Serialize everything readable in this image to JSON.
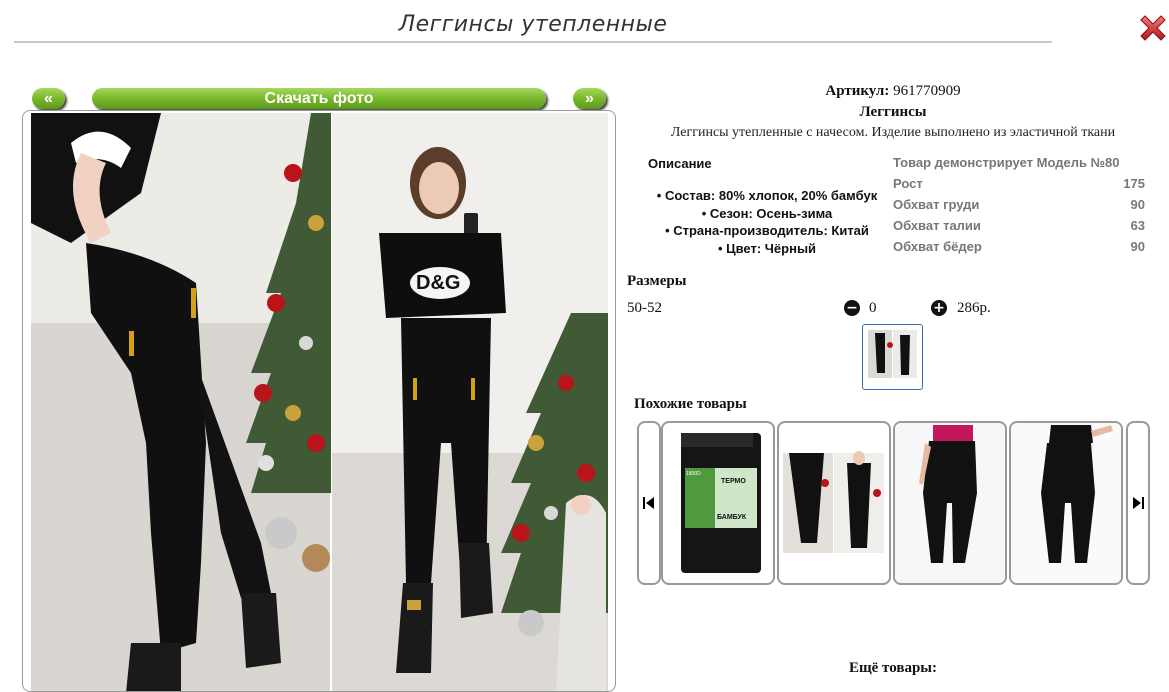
{
  "page": {
    "title": "Леггинсы утепленные",
    "close_icon": "close-icon"
  },
  "gallery": {
    "prev_label": "«",
    "next_label": "»",
    "download_label": "Скачать фото"
  },
  "product": {
    "article_label": "Артикул:",
    "article_value": "961770909",
    "name": "Леггинсы",
    "description": "Леггинсы утепленные с начесом. Изделие выполнено из эластичной ткани",
    "desc_heading": "Описание",
    "bullets": [
      "• Состав: 80% хлопок, 20% бамбук",
      "• Сезон: Осень-зима",
      "• Страна-производитель: Китай",
      "• Цвет: Чёрный"
    ]
  },
  "model": {
    "title": "Товар демонстрирует Модель №80",
    "rows": [
      {
        "label": "Рост",
        "value": "175"
      },
      {
        "label": "Обхват груди",
        "value": "90"
      },
      {
        "label": "Обхват талии",
        "value": "63"
      },
      {
        "label": "Обхват бёдер",
        "value": "90"
      }
    ]
  },
  "sizes": {
    "heading": "Размеры",
    "items": [
      {
        "size": "50-52",
        "qty": "0",
        "price": "286р."
      }
    ]
  },
  "similar": {
    "heading": "Похожие товары",
    "items": [
      {
        "name": "thermo-tights-package"
      },
      {
        "name": "leggings-dg-two-photos"
      },
      {
        "name": "black-leggings-pink-top"
      },
      {
        "name": "black-leggings-heels"
      }
    ],
    "package_text": "ТЕРМО",
    "package_sub": "БАМБУК",
    "package_code": "1800D"
  },
  "more": {
    "heading": "Ещё товары:"
  },
  "colors": {
    "green_btn": "#78b82c",
    "close_red": "#d12b2b",
    "frame_border": "#999999"
  }
}
